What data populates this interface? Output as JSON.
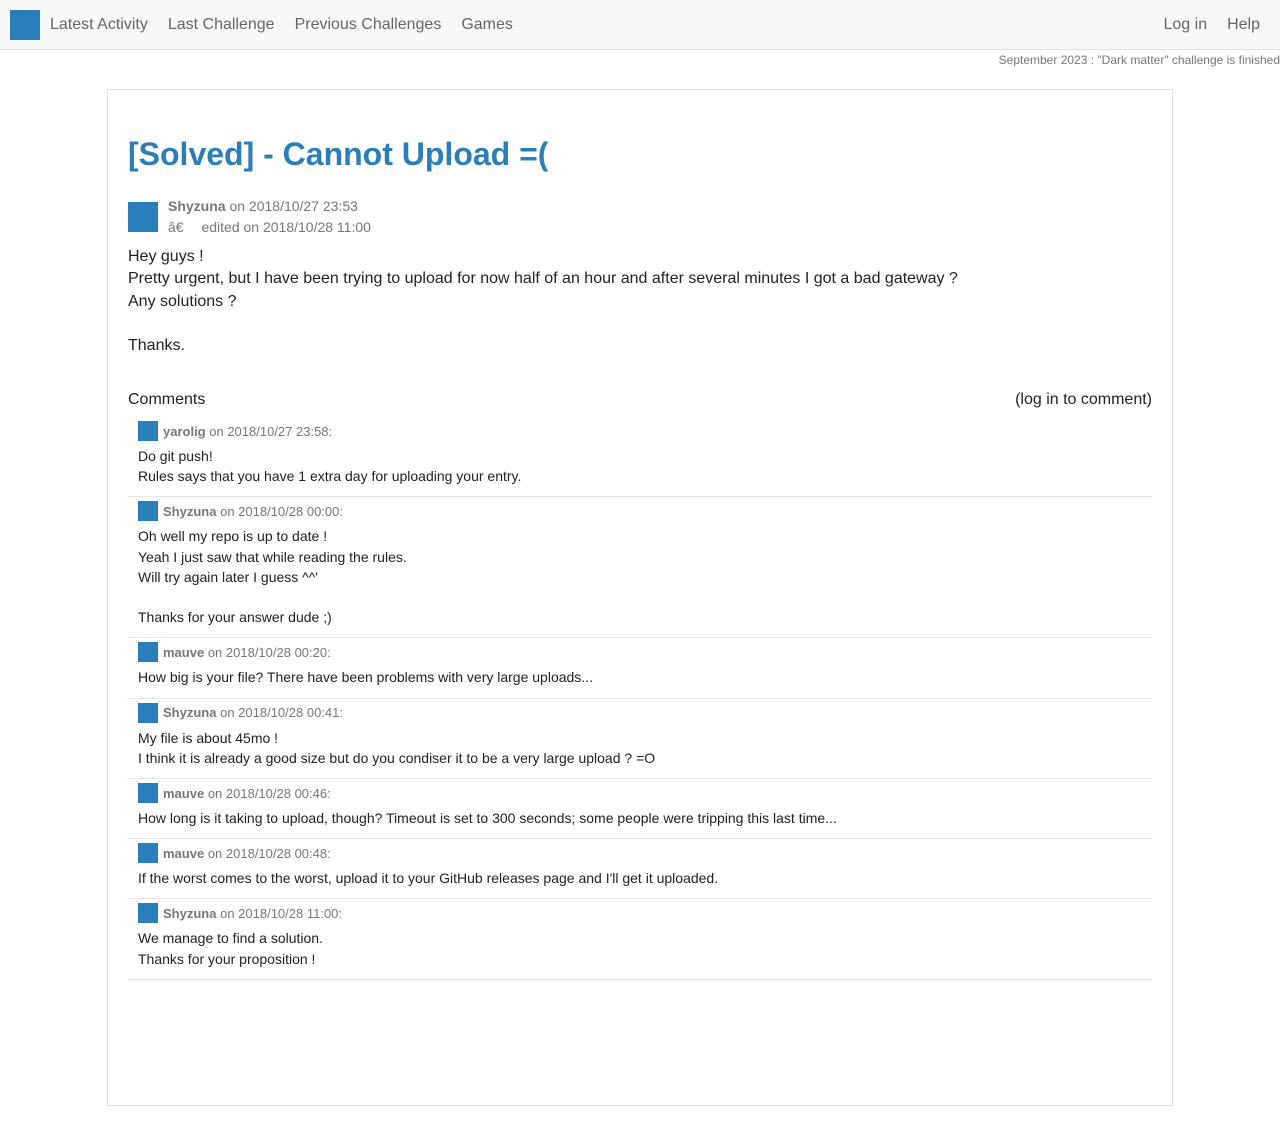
{
  "nav": {
    "left": [
      "Latest Activity",
      "Last Challenge",
      "Previous Challenges",
      "Games"
    ],
    "right": [
      "Log in",
      "Help"
    ]
  },
  "announcement": "September 2023 : \"Dark matter\" challenge is finished",
  "post": {
    "title": "[Solved] - Cannot Upload =(",
    "author": "Shyzuna",
    "date": "on 2018/10/27 23:53",
    "edit_symbol": "â€",
    "edited": "edited on 2018/10/28 11:00",
    "body": [
      "Hey guys !",
      "Pretty urgent, but I have been trying to upload for now half of an hour and after several minutes I got a bad gateway ?",
      "Any solutions ?",
      "",
      "Thanks."
    ]
  },
  "comments_section": {
    "label": "Comments",
    "login_hint": "(log in to comment)"
  },
  "comments": [
    {
      "author": "yarolig",
      "date": "on 2018/10/27 23:58:",
      "lines": [
        "Do git push!",
        "Rules says that you have 1 extra day for uploading your entry."
      ]
    },
    {
      "author": "Shyzuna",
      "date": "on 2018/10/28 00:00:",
      "lines": [
        "Oh well my repo is up to date !",
        "Yeah I just saw that while reading the rules.",
        "Will try again later I guess ^^'",
        "",
        "Thanks for your answer dude ;)"
      ]
    },
    {
      "author": "mauve",
      "date": "on 2018/10/28 00:20:",
      "lines": [
        "How big is your file? There have been problems with very large uploads..."
      ]
    },
    {
      "author": "Shyzuna",
      "date": "on 2018/10/28 00:41:",
      "lines": [
        "My file is about 45mo !",
        "I think it is already a good size but do you condiser it to be a very large upload ? =O"
      ]
    },
    {
      "author": "mauve",
      "date": "on 2018/10/28 00:46:",
      "lines": [
        "How long is it taking to upload, though? Timeout is set to 300 seconds; some people were tripping this last time..."
      ]
    },
    {
      "author": "mauve",
      "date": "on 2018/10/28 00:48:",
      "lines": [
        "If the worst comes to the worst, upload it to your GitHub releases page and I'll get it uploaded."
      ]
    },
    {
      "author": "Shyzuna",
      "date": "on 2018/10/28 11:00:",
      "lines": [
        "We manage to find a solution.",
        "Thanks for your proposition !"
      ]
    }
  ]
}
